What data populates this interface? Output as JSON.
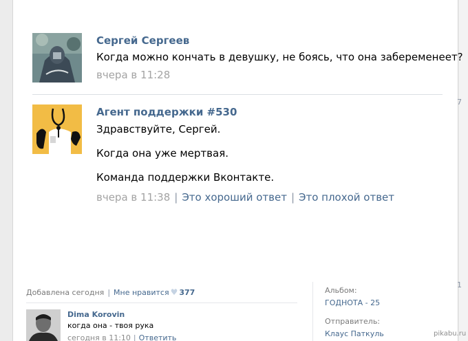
{
  "messages": [
    {
      "author": "Сергей Сергеев",
      "lines": [
        "Когда можно кончать в девушку, не боясь, что она забеременеет?"
      ],
      "time": "вчера в 11:28"
    },
    {
      "author": "Агент поддержки #530",
      "lines": [
        "Здравствуйте, Сергей.",
        "Когда она уже мертвая.",
        "Команда поддержки Вконтакте."
      ],
      "time": "вчера в 11:38",
      "good_answer": "Это хороший ответ",
      "bad_answer": "Это плохой ответ"
    }
  ],
  "post": {
    "added": "Добавлена сегодня",
    "likes_label": "Мне нравится",
    "likes_count": "377"
  },
  "comment": {
    "author": "Dima Korovin",
    "text": "когда она - твоя рука",
    "time": "сегодня в 11:10",
    "reply": "Ответить"
  },
  "info": {
    "album_label": "Альбом:",
    "album_value": "ГОДНОТА - 25",
    "sender_label": "Отправитель:",
    "sender_value": "Клаус Паткуль"
  },
  "watermark": "pikabu.ru",
  "side_fragments": [
    "7",
    "1"
  ]
}
